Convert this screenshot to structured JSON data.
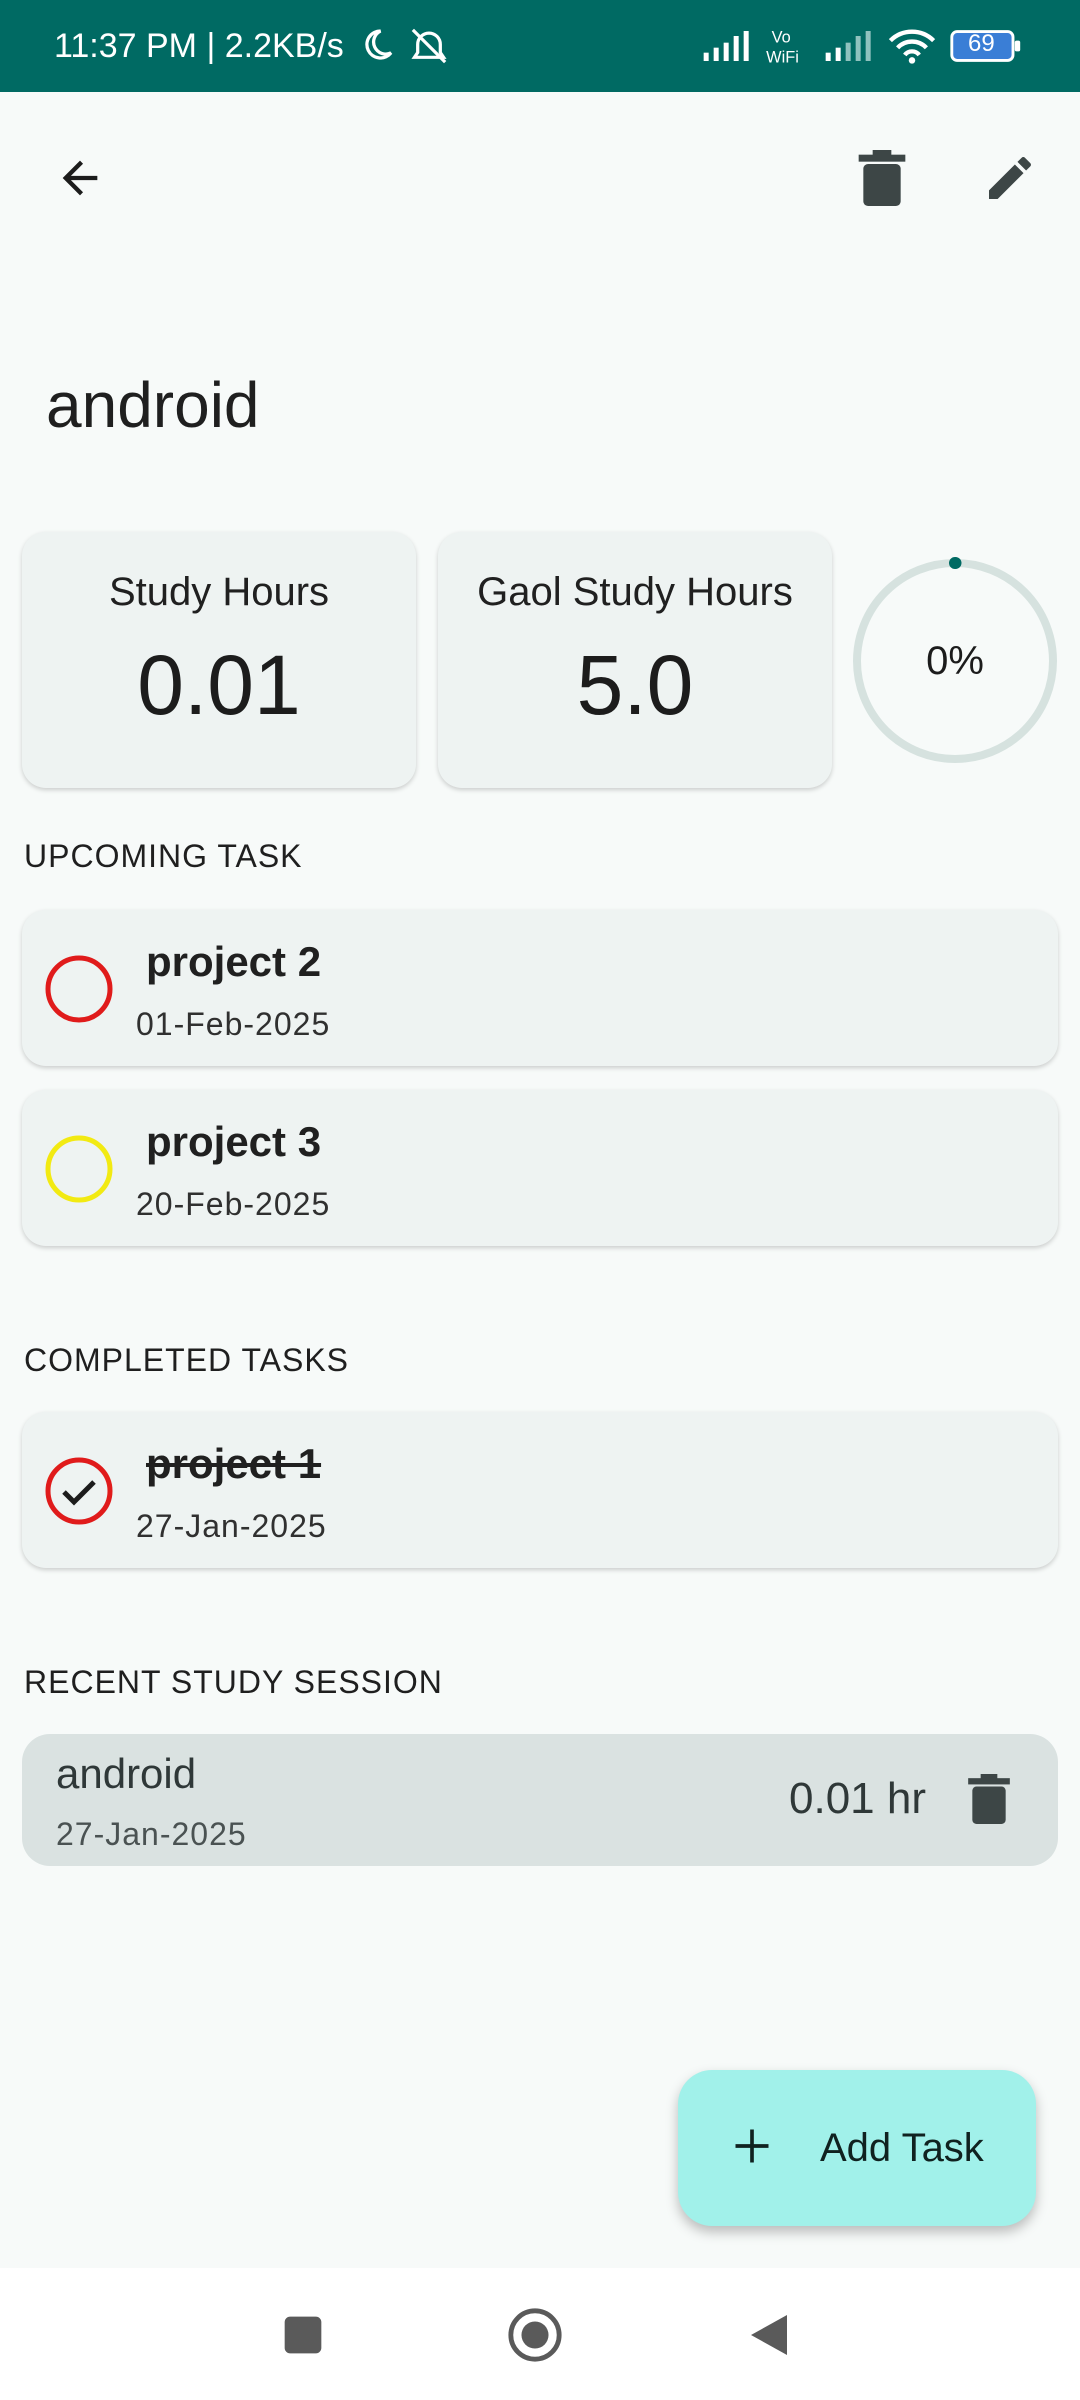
{
  "status_bar": {
    "time_speed": "11:37 PM | 2.2KB/s",
    "vowifi_label": "Vo WiFi",
    "battery_level": "69"
  },
  "subject": {
    "name": "android"
  },
  "stats": {
    "study_hours_label": "Study Hours",
    "study_hours_value": "0.01",
    "goal_hours_label": "Gaol Study Hours",
    "goal_hours_value": "5.0",
    "progress_text": "0%",
    "progress_fraction": 0
  },
  "upcoming": {
    "header": "UPCOMING TASK",
    "tasks": [
      {
        "title": "project 2",
        "date": "01-Feb-2025",
        "priority_color": "#e01b1b"
      },
      {
        "title": "project 3",
        "date": "20-Feb-2025",
        "priority_color": "#f2ea12"
      }
    ]
  },
  "completed": {
    "header": "COMPLETED TASKS",
    "tasks": [
      {
        "title": "project 1",
        "date": "27-Jan-2025",
        "priority_color": "#e01b1b"
      }
    ]
  },
  "sessions": {
    "header": "RECENT STUDY SESSION",
    "items": [
      {
        "name": "android",
        "date": "27-Jan-2025",
        "hours": "0.01 hr"
      }
    ]
  },
  "fab": {
    "label": "Add Task"
  },
  "colors": {
    "status_bar": "#006a63",
    "accent": "#006a63",
    "fab": "#a1f1ea",
    "card": "#eef3f2",
    "session_card": "#dae2e1"
  },
  "icons": {
    "back": "arrow-left-icon",
    "delete": "trash-icon",
    "edit": "pencil-icon",
    "add": "plus-icon",
    "nav_recents": "square-icon",
    "nav_home": "circle-icon",
    "nav_back": "triangle-back-icon"
  }
}
